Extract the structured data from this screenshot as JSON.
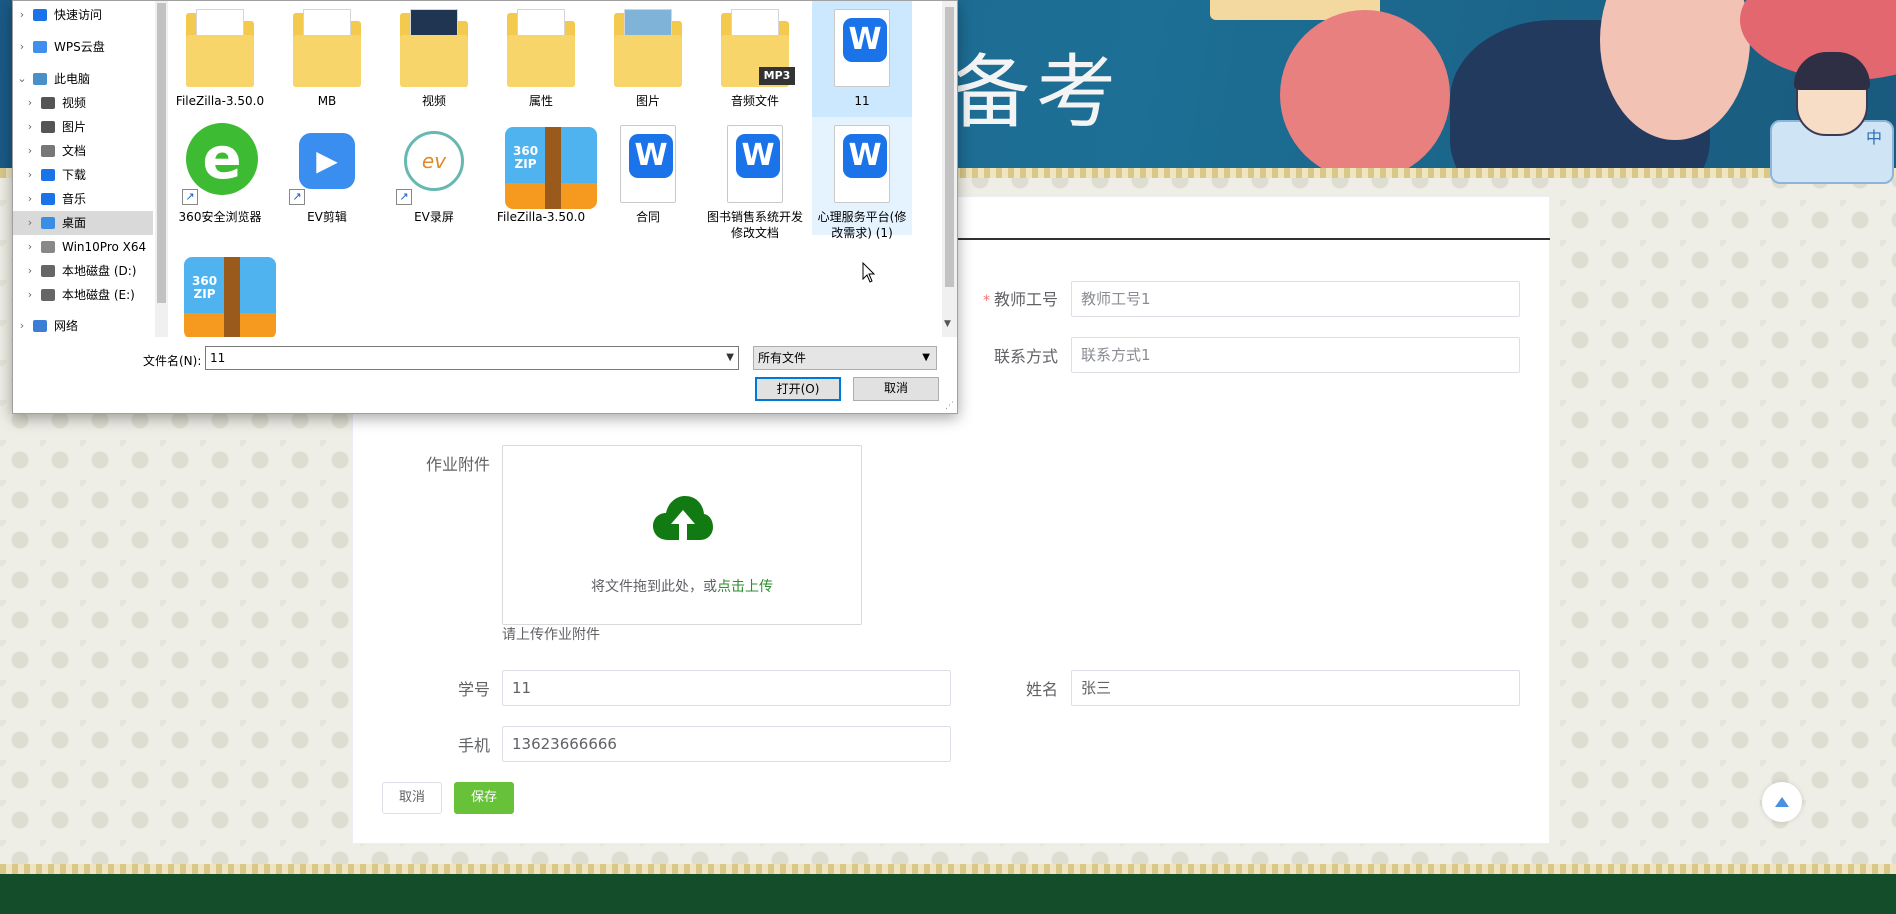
{
  "banner": {
    "title": "备考",
    "mascot_text": "中"
  },
  "form": {
    "teacher_id": {
      "label": "教师工号",
      "placeholder": "教师工号1"
    },
    "contact": {
      "label": "联系方式",
      "placeholder": "联系方式1"
    },
    "attachment": {
      "label": "作业附件",
      "drop_text": "将文件拖到此处，或",
      "click_text": "点击上传",
      "tip": "请上传作业附件"
    },
    "student_no": {
      "label": "学号",
      "value": "11"
    },
    "name": {
      "label": "姓名",
      "value": "张三"
    },
    "phone": {
      "label": "手机",
      "value": "13623666666"
    },
    "cancel_label": "取消",
    "save_label": "保存"
  },
  "dialog": {
    "nav": [
      {
        "label": "快速访问",
        "icon": "star-icon",
        "color": "#1a73e8"
      },
      {
        "label": "WPS云盘",
        "icon": "cloud-icon",
        "color": "#3f8ef0"
      },
      {
        "label": "此电脑",
        "icon": "computer-icon",
        "color": "#4a90c8",
        "expanded": true
      },
      {
        "label": "视频",
        "icon": "video-icon",
        "color": "#555555"
      },
      {
        "label": "图片",
        "icon": "image-icon",
        "color": "#555555"
      },
      {
        "label": "文档",
        "icon": "document-icon",
        "color": "#777777"
      },
      {
        "label": "下载",
        "icon": "download-icon",
        "color": "#1a73e8"
      },
      {
        "label": "音乐",
        "icon": "music-icon",
        "color": "#1a73e8"
      },
      {
        "label": "桌面",
        "icon": "desktop-icon",
        "color": "#3a8ee6",
        "selected": true
      },
      {
        "label": "Win10Pro X64",
        "icon": "drive-icon",
        "color": "#888888"
      },
      {
        "label": "本地磁盘 (D:)",
        "icon": "drive-icon",
        "color": "#666666"
      },
      {
        "label": "本地磁盘 (E:)",
        "icon": "drive-icon",
        "color": "#666666"
      },
      {
        "label": "网络",
        "icon": "network-icon",
        "color": "#3a7fd5"
      }
    ],
    "files": [
      {
        "name": "FileZilla-3.50.0",
        "type": "folder-doc"
      },
      {
        "name": "MB",
        "type": "folder-doc"
      },
      {
        "name": "视频",
        "type": "folder-video"
      },
      {
        "name": "属性",
        "type": "folder-doc"
      },
      {
        "name": "图片",
        "type": "folder-image"
      },
      {
        "name": "音频文件",
        "type": "folder-mp3"
      },
      {
        "name": "11",
        "type": "wps",
        "selected": true
      },
      {
        "name": "360安全浏览器",
        "type": "browser"
      },
      {
        "name": "EV剪辑",
        "type": "ev-edit"
      },
      {
        "name": "EV录屏",
        "type": "ev-record"
      },
      {
        "name": "FileZilla-3.50.0",
        "type": "zip"
      },
      {
        "name": "合同",
        "type": "wps"
      },
      {
        "name": "图书销售系统开发修改文档",
        "type": "wps"
      },
      {
        "name": "心理服务平台(修改需求) (1)",
        "type": "wps",
        "hover": true
      },
      {
        "name": "",
        "type": "zip"
      }
    ],
    "filename_label": "文件名(N):",
    "filename_value": "11",
    "filetype_value": "所有文件",
    "open_label": "打开(O)",
    "cancel_label": "取消",
    "mp3_badge": "MP3",
    "zip_text": "360\nZIP",
    "wps_glyph": "W"
  }
}
